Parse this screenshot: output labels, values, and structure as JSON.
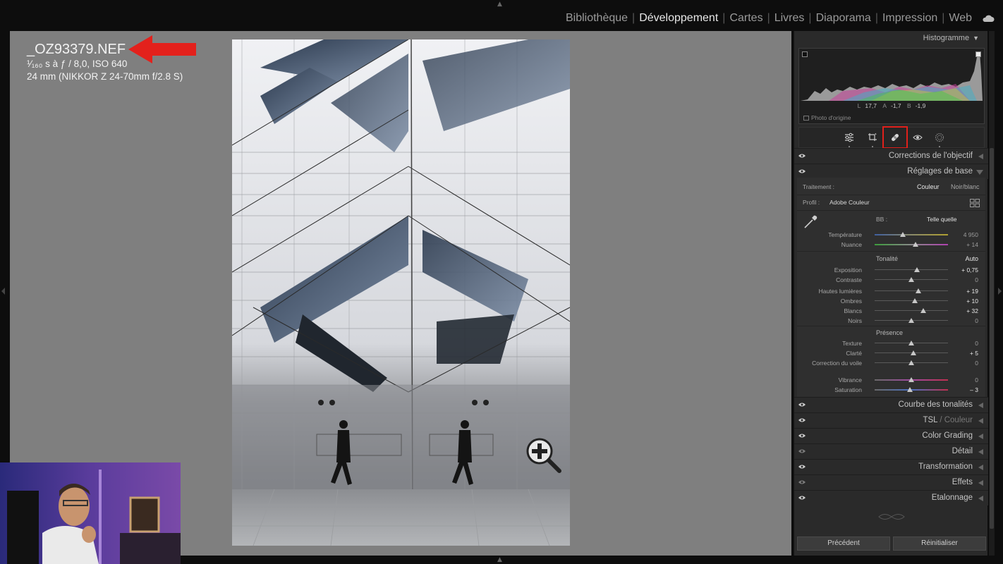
{
  "modules": [
    "Bibliothèque",
    "Développement",
    "Cartes",
    "Livres",
    "Diaporama",
    "Impression",
    "Web"
  ],
  "active_module": "Développement",
  "photo_info": {
    "filename": "_OZ93379.NEF",
    "exposure": "¹⁄₁₆₀ s à ƒ / 8,0, ISO 640",
    "lens": "24 mm (NIKKOR Z 24-70mm f/2.8 S)"
  },
  "histogram": {
    "title": "Histogramme",
    "L_label": "L",
    "L": "17,7",
    "A_label": "A",
    "A": "-1,7",
    "B_label": "B",
    "B": "-1,9",
    "original_label": "Photo d'origine"
  },
  "tools": [
    "edit-sliders-icon",
    "crop-icon",
    "healing-icon",
    "redeye-icon",
    "masking-icon"
  ],
  "active_tool": "healing-icon",
  "sections_top": {
    "lens": "Corrections de l'objectif",
    "basic": "Réglages de base"
  },
  "basic": {
    "treatment_label": "Traitement :",
    "color": "Couleur",
    "bw": "Noir/blanc",
    "profile_label": "Profil :",
    "profile_value": "Adobe Couleur",
    "wb_label": "BB :",
    "wb_value": "Telle quelle",
    "temperature_label": "Température",
    "temperature_value": "4 950",
    "temperature_pos": 0.38,
    "tint_label": "Nuance",
    "tint_value": "+ 14",
    "tint_pos": 0.56,
    "tone_label": "Tonalité",
    "auto_label": "Auto",
    "exposure_label": "Exposition",
    "exposure_value": "+ 0,75",
    "exposure_pos": 0.58,
    "contrast_label": "Contraste",
    "contrast_value": "0",
    "contrast_pos": 0.5,
    "highlights_label": "Hautes lumières",
    "highlights_value": "+ 19",
    "highlights_pos": 0.6,
    "shadows_label": "Ombres",
    "shadows_value": "+ 10",
    "shadows_pos": 0.55,
    "whites_label": "Blancs",
    "whites_value": "+ 32",
    "whites_pos": 0.66,
    "blacks_label": "Noirs",
    "blacks_value": "0",
    "blacks_pos": 0.5,
    "presence_label": "Présence",
    "texture_label": "Texture",
    "texture_value": "0",
    "texture_pos": 0.5,
    "clarity_label": "Clarté",
    "clarity_value": "+ 5",
    "clarity_pos": 0.53,
    "dehaze_label": "Correction du voile",
    "dehaze_value": "0",
    "dehaze_pos": 0.5,
    "vibrance_label": "Vibrance",
    "vibrance_value": "0",
    "vibrance_pos": 0.5,
    "saturation_label": "Saturation",
    "saturation_value": "– 3",
    "saturation_pos": 0.48
  },
  "sections_bottom": {
    "tone_curve": "Courbe des tonalités",
    "hsl": "TSL",
    "hsl_dim": " / Couleur",
    "color_grading": "Color Grading",
    "detail": "Détail",
    "transform": "Transformation",
    "effects": "Effets",
    "calibration": "Etalonnage"
  },
  "buttons": {
    "previous": "Précédent",
    "reset": "Réinitialiser"
  },
  "colors": {
    "highlight_red": "#e0201b",
    "arrow_red": "#e3211c"
  }
}
